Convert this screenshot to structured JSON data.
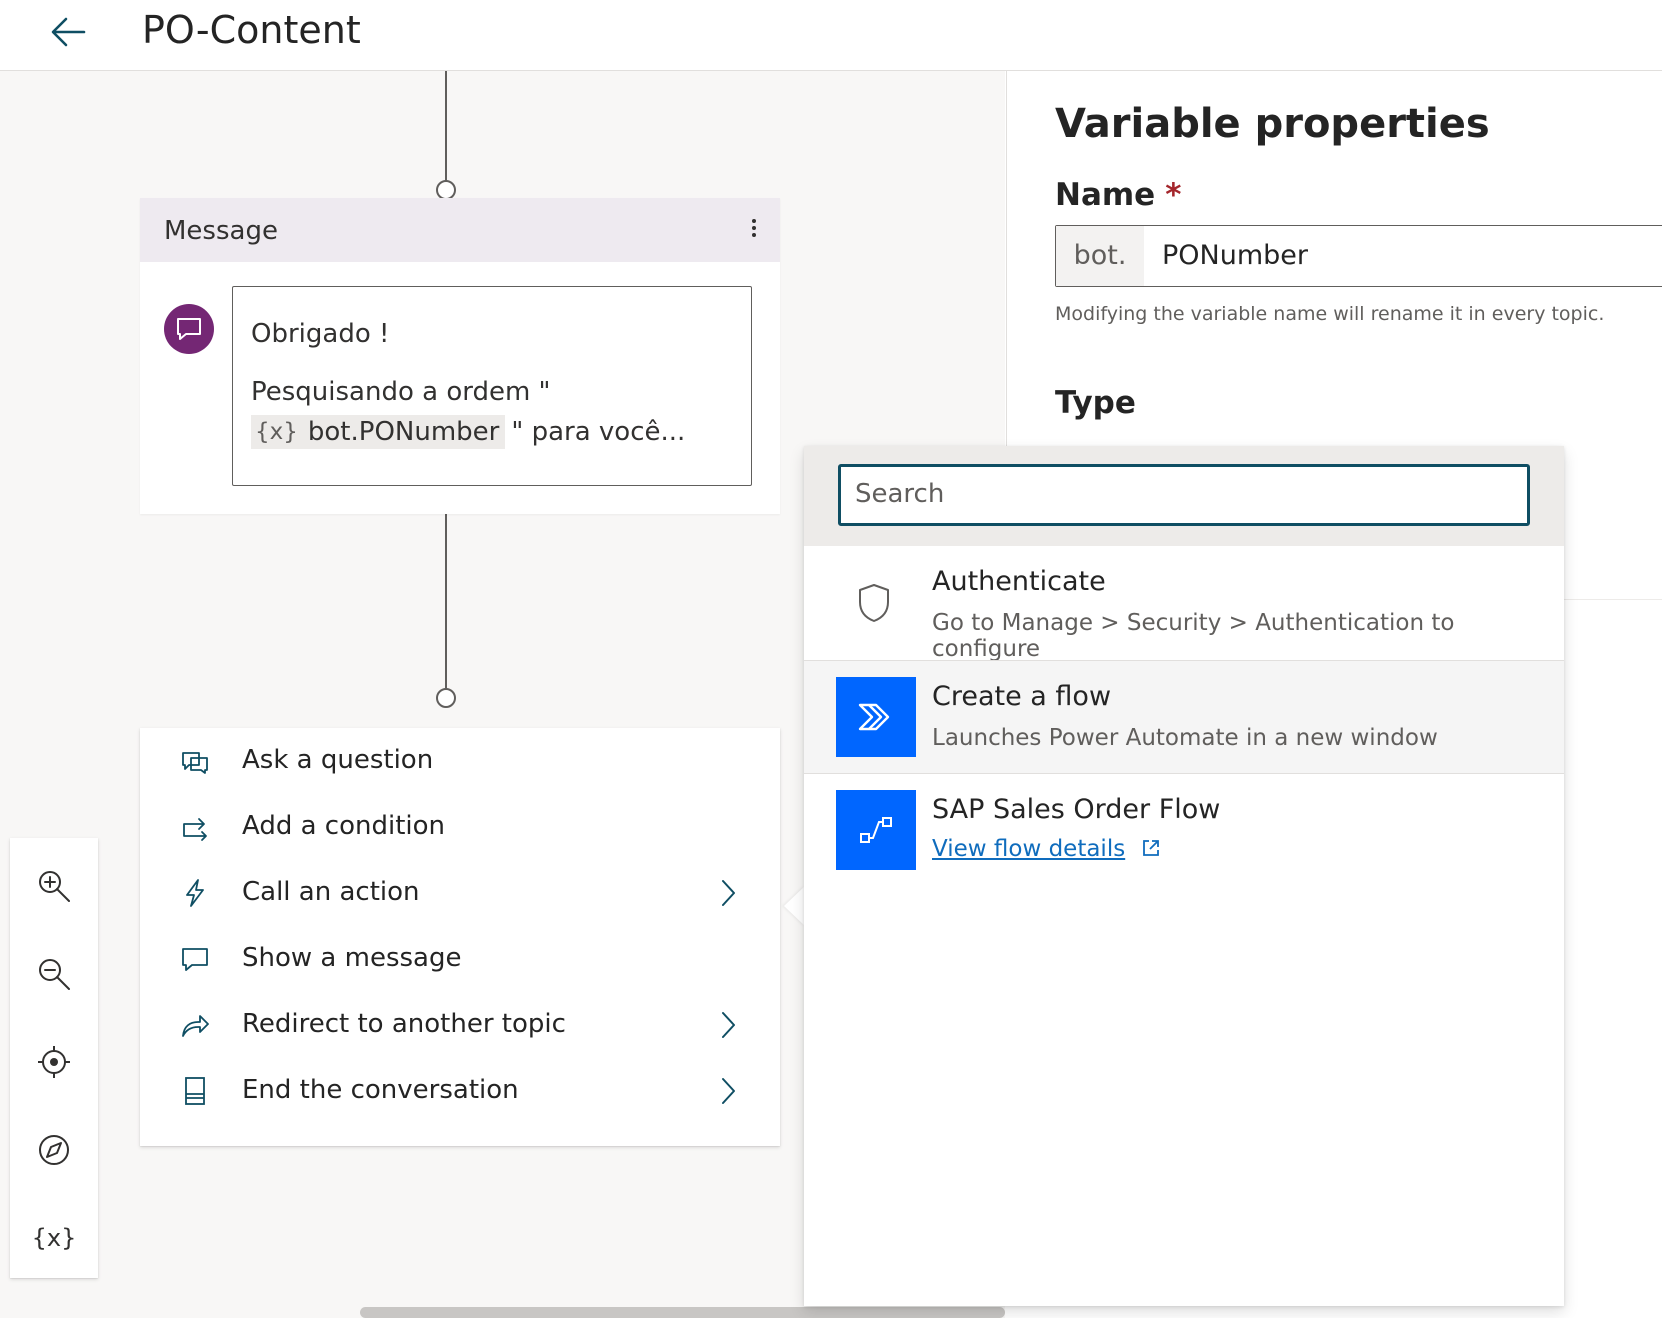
{
  "header": {
    "back_icon": "arrow-left-icon",
    "title": "PO-Content"
  },
  "message_node": {
    "header_title": "Message",
    "line1": "Obrigado !",
    "line2": "Pesquisando a ordem \"",
    "variable_chip_icon": "{x}",
    "variable_name": "bot.PONumber",
    "line3_suffix": "\" para você...",
    "avatar_icon": "chat-bubble-icon",
    "avatar_color": "#742774"
  },
  "action_menu": {
    "items": [
      {
        "label": "Ask a question",
        "icon": "question-bubble-icon",
        "has_submenu": false
      },
      {
        "label": "Add a condition",
        "icon": "branch-icon",
        "has_submenu": false
      },
      {
        "label": "Call an action",
        "icon": "lightning-icon",
        "has_submenu": true
      },
      {
        "label": "Show a message",
        "icon": "message-icon",
        "has_submenu": false
      },
      {
        "label": "Redirect to another topic",
        "icon": "redirect-arrow-icon",
        "has_submenu": true
      },
      {
        "label": "End the conversation",
        "icon": "end-icon",
        "has_submenu": true
      }
    ]
  },
  "zoom_toolbar": {
    "zoom_in": "zoom-in-icon",
    "zoom_out": "zoom-out-icon",
    "center": "target-icon",
    "compass": "compass-icon",
    "variables": "{x}"
  },
  "variable_properties": {
    "title": "Variable properties",
    "name_label": "Name",
    "required_marker": "*",
    "name_prefix": "bot.",
    "name_value": "PONumber",
    "name_hint": "Modifying the variable name will rename it in every topic.",
    "type_label": "Type"
  },
  "action_flyout": {
    "search_placeholder": "Search",
    "items": [
      {
        "title": "Authenticate",
        "subtitle": "Go to Manage > Security > Authentication to configure",
        "icon": "shield-icon"
      },
      {
        "title": "Create a flow",
        "subtitle": "Launches Power Automate in a new window",
        "icon": "power-automate-icon"
      },
      {
        "title": "SAP Sales Order Flow",
        "link": "View flow details",
        "icon": "flow-icon"
      }
    ],
    "accent_color": "#0066ff",
    "search_border_color": "#0f4e63"
  }
}
